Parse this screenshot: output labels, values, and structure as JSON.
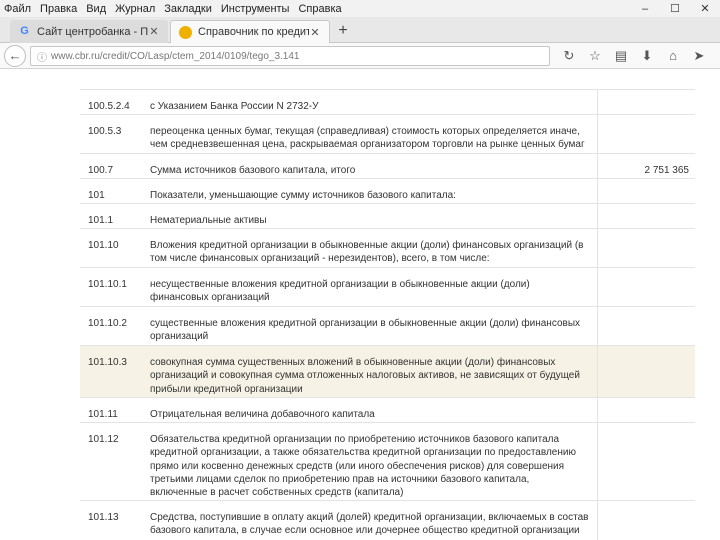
{
  "menubar": {
    "items": [
      "Файл",
      "Правка",
      "Вид",
      "Журнал",
      "Закладки",
      "Инструменты",
      "Справка"
    ]
  },
  "tabs": [
    {
      "label": "Сайт центробанка - Поис…",
      "icon": "google-icon",
      "active": false
    },
    {
      "label": "Справочник по кредитны…",
      "icon": "cbr-icon",
      "active": true
    }
  ],
  "navbar": {
    "url": "www.cbr.ru/credit/CO/Lasp/ctem_2014/0109/tego_3.141"
  },
  "table": {
    "rows": [
      {
        "code": "100.5.2.4",
        "desc": "с Указанием Банка России N 2732-У",
        "value": "",
        "h": 25
      },
      {
        "code": "100.5.3",
        "desc": "переоценка ценных бумаг, текущая (справедливая) стоимость которых определяется иначе, чем средневзвешенная цена, раскрываемая организатором торговли на рынке ценных бумаг",
        "value": "",
        "h": 39
      },
      {
        "code": "100.7",
        "desc": "Сумма источников базового капитала, итого",
        "value": "2 751 365",
        "h": 25
      },
      {
        "code": "101",
        "desc": "Показатели, уменьшающие сумму источников базового капитала:",
        "value": "",
        "h": 25
      },
      {
        "code": "101.1",
        "desc": "Нематериальные активы",
        "value": "",
        "h": 25
      },
      {
        "code": "101.10",
        "desc": "Вложения кредитной организации в обыкновенные акции (доли) финансовых организаций (в том числе финансовых организаций - нерезидентов), всего, в том числе:",
        "value": "",
        "h": 39
      },
      {
        "code": "101.10.1",
        "desc": "несущественные вложения кредитной организации в обыкновенные акции (доли) финансовых организаций",
        "value": "",
        "h": 39
      },
      {
        "code": "101.10.2",
        "desc": "существенные вложения кредитной организации в обыкновенные акции (доли) финансовых организаций",
        "value": "",
        "h": 39
      },
      {
        "code": "101.10.3",
        "desc": "совокупная сумма существенных вложений в обыкновенные акции (доли) финансовых организаций и совокупная сумма отложенных налоговых активов, не зависящих от будущей прибыли кредитной организации",
        "value": "",
        "h": 52,
        "highlight": true
      },
      {
        "code": "101.11",
        "desc": "Отрицательная величина добавочного капитала",
        "value": "",
        "h": 25
      },
      {
        "code": "101.12",
        "desc": "Обязательства кредитной организации по приобретению источников базового капитала кредитной организации, а также обязательства кредитной организации по предоставлению прямо или косвенно денежных средств (или иного обеспечения рисков) для совершения третьими лицами сделок по приобретению прав на источники базового капитала, включенные в расчет собственных средств (капитала)",
        "value": "",
        "h": 78
      },
      {
        "code": "101.13",
        "desc": "Средства, поступившие в оплату акций (долей) кредитной организации, включаемых в состав базового капитала, в случае если основное или дочернее общество кредитной организации или",
        "value": "",
        "h": 60
      }
    ]
  }
}
